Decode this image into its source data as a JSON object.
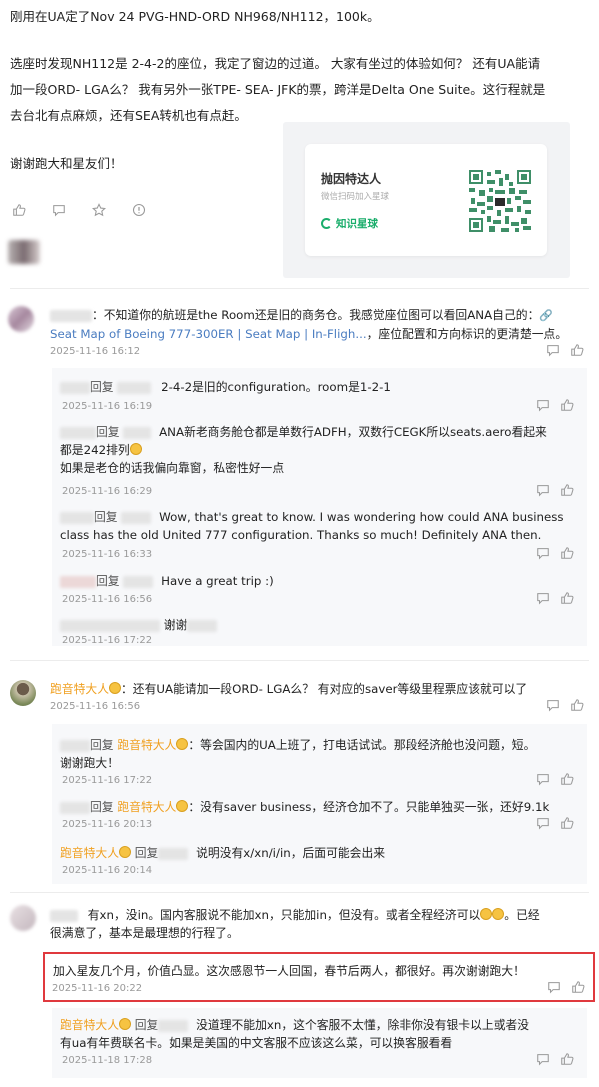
{
  "post": {
    "line1": "刚用在UA定了Nov 24 PVG-HND-ORD NH968/NH112，100k。",
    "para2_l1": "选座时发现NH112是 2-4-2的座位，我定了窗边的过道。 大家有坐过的体验如何？ 还有UA能请",
    "para2_l2": "加一段ORD- LGA么？ 我有另外一张TPE- SEA- JFK的票，跨洋是Delta  One Suite。这行程就是",
    "para2_l3": "去台北有点麻烦，还有SEA转机也有点赶。",
    "thanks": "谢谢跑大和星友们！"
  },
  "planet_card": {
    "title": "抛因特达人",
    "subtitle": "微信扫码加入星球",
    "brand": "知识星球"
  },
  "comments": [
    {
      "text_pre": "：不知道你的航班是the Room还是旧的商务仓。我感觉座位图可以看回ANA自己的：",
      "link_text": "Seat Map of Boeing 777-300ER | Seat Map | In-Fligh...",
      "text_post": "，座位配置和方向标识的更清楚一点。",
      "time": "2025-11-16 16:12"
    }
  ],
  "replies1": [
    {
      "reply_word": "回复",
      "text": "2-4-2是旧的configuration。room是1-2-1",
      "time": "2025-11-16 16:19"
    },
    {
      "reply_word": "回复",
      "text_l1": "ANA新老商务舱仓都是单数行ADFH，双数行CEGK所以seats.aero看起来",
      "text_l2": "都是242排列",
      "text_l3": "如果是老仓的话我偏向靠窗，私密性好一点",
      "time": "2025-11-16 16:29"
    },
    {
      "reply_word": "回复",
      "text_l1": "Wow, that's great to know. I was wondering how could ANA business",
      "text_l2": "class has the old United 777 configuration. Thanks so much! Definitely ANA then.",
      "time": "2025-11-16 16:33"
    },
    {
      "reply_word": "回复",
      "text": "Have a great trip :)",
      "time": "2025-11-16 16:56"
    },
    {
      "reply_word": "谢谢",
      "time": "2025-11-16 17:22"
    }
  ],
  "comment2": {
    "name": "跑音特大人",
    "text": "：还有UA能请加一段ORD- LGA么？ 有对应的saver等级里程票应该就可以了",
    "time": "2025-11-16 16:56"
  },
  "replies2": [
    {
      "reply_word": "回复",
      "name": "跑音特大人",
      "text_l1": "：等会国内的UA上班了，打电话试试。那段经济舱也没问题，短。",
      "text_l2": "谢谢跑大！",
      "time": "2025-11-16 17:22"
    },
    {
      "reply_word": "回复",
      "name": "跑音特大人",
      "text": "：没有saver business，经济仓加不了。只能单独买一张，还好9.1k",
      "time": "2025-11-16 20:13"
    },
    {
      "from": "跑音特大人",
      "reply_word": "回复",
      "text": "说明没有x/xn/i/in，后面可能会出来",
      "time": "2025-11-16 20:14"
    }
  ],
  "comment3": {
    "text_l1": "有xn，没in。国内客服说不能加xn，只能加in，但没有。或者全程经济可以",
    "text_l1_end": "。已经",
    "text_l2": "很满意了，基本是最理想的行程了。"
  },
  "highlight": {
    "text": "加入星友几个月，价值凸显。这次感恩节一人回国，春节后两人，都很好。再次谢谢跑大！",
    "time": "2025-11-16 20:22"
  },
  "last_reply": {
    "from": "跑音特大人",
    "reply_word": "回复",
    "text_l1": "没道理不能加xn，这个客服不太懂，除非你没有银卡以上或者没",
    "text_l2": "有ua有年费联名卡。如果是美国的中文客服不应该这么菜，可以换客服看看",
    "time": "2025-11-18 17:28"
  },
  "colors": {
    "name": "#f0a020",
    "link": "#4a7cc0",
    "highlight_border": "#e0393e",
    "brand": "#1aad6b"
  }
}
